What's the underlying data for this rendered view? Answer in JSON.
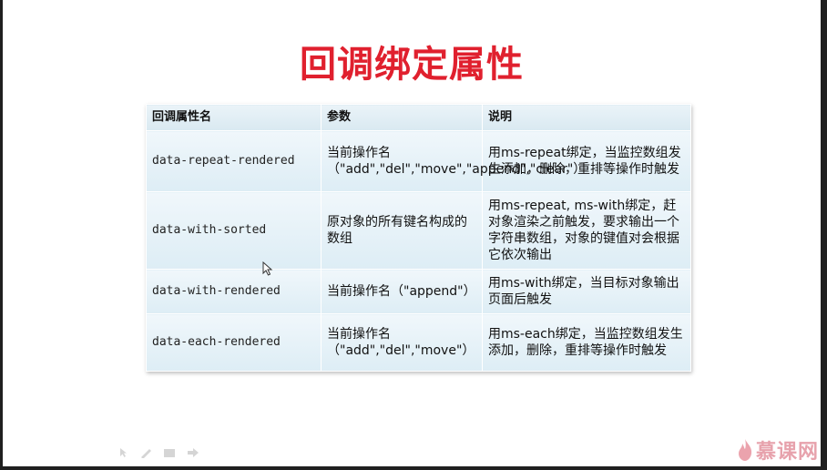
{
  "slide": {
    "title": "回调绑定属性"
  },
  "table": {
    "headers": [
      "回调属性名",
      "参数",
      "说明"
    ],
    "rows": [
      {
        "name": "data-repeat-rendered",
        "params": "当前操作名（\"add\",\"del\",\"move\",\"append\",\"clear\"）",
        "desc": "用ms-repeat绑定，当监控数组发生添加，删除，重排等操作时触发"
      },
      {
        "name": "data-with-sorted",
        "params": "原对象的所有键名构成的数组",
        "desc": "用ms-repeat, ms-with绑定，赶对象渲染之前触发，要求输出一个字符串数组，对象的键值对会根据它依次输出"
      },
      {
        "name": "data-with-rendered",
        "params": "当前操作名（\"append\"）",
        "desc": "用ms-with绑定，当目标对象输出页面后触发"
      },
      {
        "name": "data-each-rendered",
        "params": "当前操作名（\"add\",\"del\",\"move\"）",
        "desc": "用ms-each绑定，当监控数组发生添加，删除，重排等操作时触发"
      }
    ]
  },
  "watermark": {
    "logo_text": "慕课网",
    "logo_icon": "flame-icon"
  },
  "toolbar_icons": [
    "arrow-icon",
    "pen-icon",
    "menu-icon",
    "next-icon"
  ],
  "colors": {
    "title": "#e0202e",
    "table_bg": "#ddedf5",
    "logo": "#e7a2ac"
  }
}
